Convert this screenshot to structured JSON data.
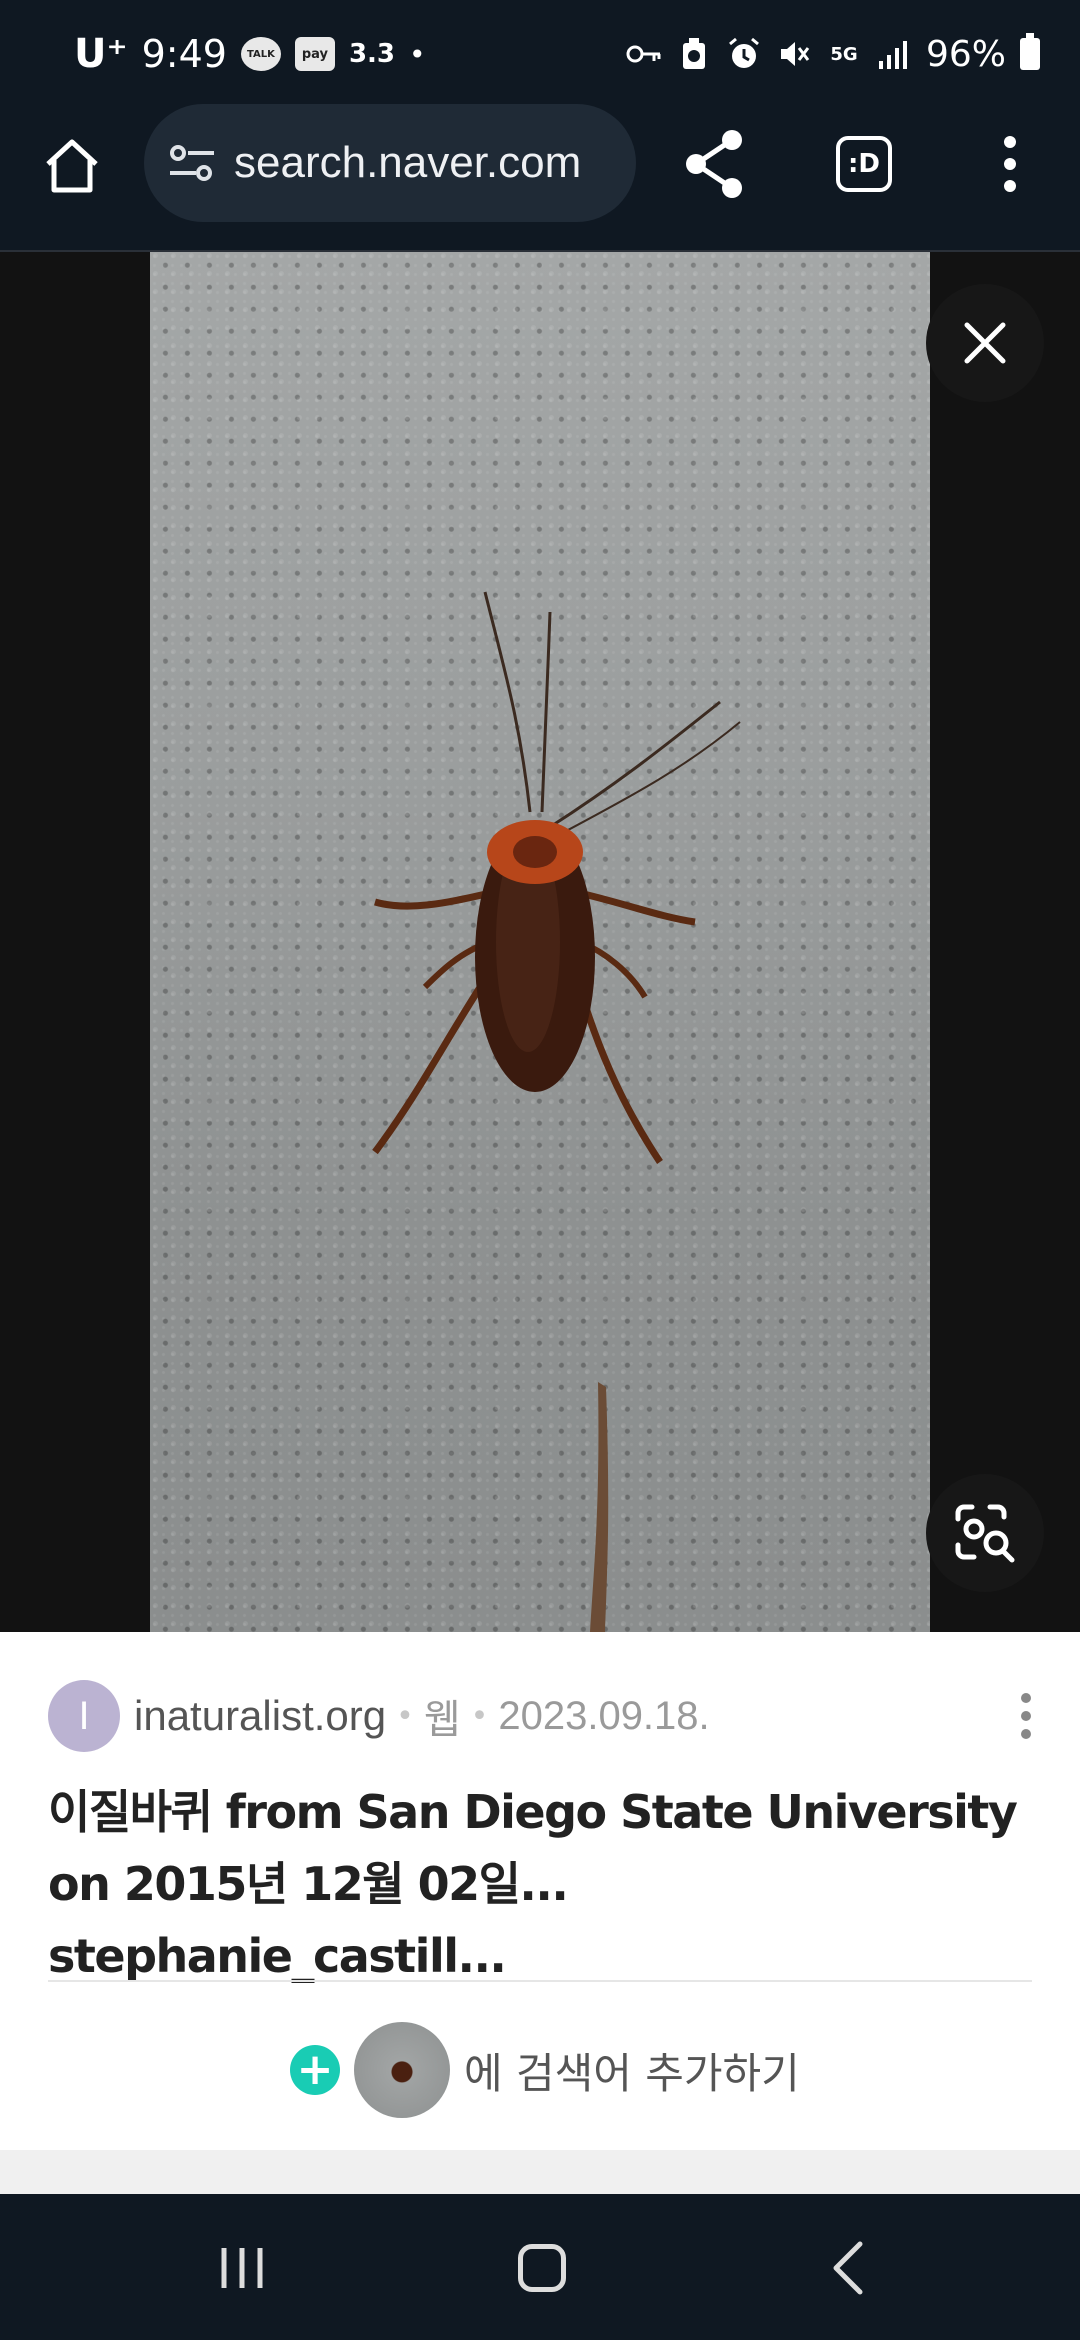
{
  "status_bar": {
    "carrier": "U⁺",
    "time": "9:49",
    "talk_badge": "TALK",
    "pay_badge": "pay",
    "temp": "3.3",
    "dot": "•",
    "network": "5G",
    "battery": "96%"
  },
  "browser": {
    "url": "search.naver.com",
    "tabs_label": ":D"
  },
  "result": {
    "avatar_letter": "I",
    "site": "inaturalist.org",
    "sep1": "•",
    "type": "웹",
    "sep2": "•",
    "date": "2023.09.18.",
    "title": "이질바퀴 from San Diego State University on 2015년 12월 02일... stephanie_castill...",
    "add_search_text": "에 검색어 추가하기",
    "plus_symbol": "+"
  },
  "colors": {
    "accent_plus": "#19ccb4",
    "avatar_bg": "#bbb3d2"
  },
  "icons": [
    "home-icon",
    "tune-icon",
    "share-icon",
    "tabs-icon",
    "more-vert-icon",
    "close-icon",
    "lens-search-icon",
    "recents-icon",
    "nav-home-icon",
    "back-icon"
  ]
}
